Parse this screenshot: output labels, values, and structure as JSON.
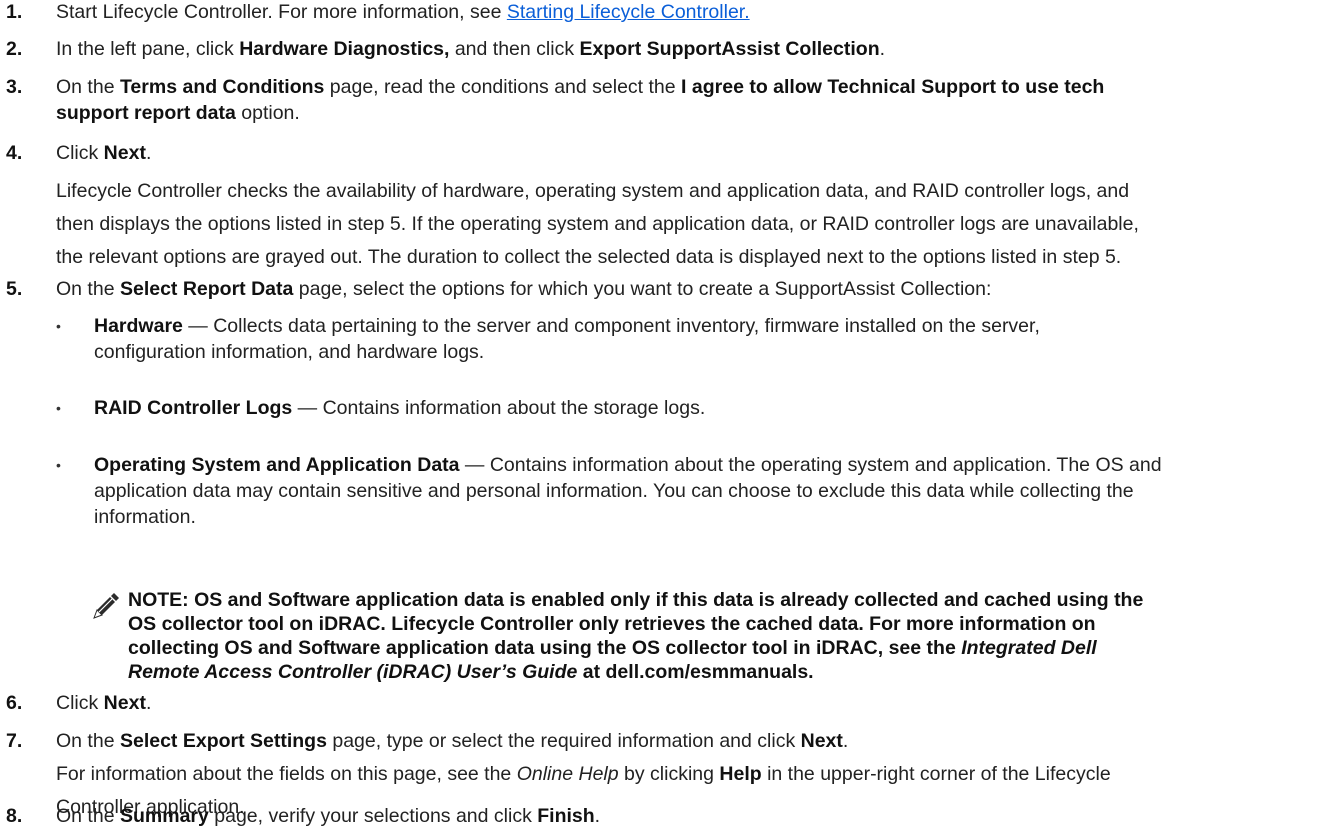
{
  "steps": [
    {
      "num": "1.",
      "pre": "Start Lifecycle Controller. For more information, see ",
      "link": "Starting Lifecycle Controller."
    },
    {
      "num": "2.",
      "t1": "In the left pane, click ",
      "b1": "Hardware Diagnostics,",
      "t2": " and then click ",
      "b2": "Export SupportAssist Collection",
      "t3": "."
    },
    {
      "num": "3.",
      "t1": "On the ",
      "b1": "Terms and Conditions",
      "t2": " page, read the conditions and select the ",
      "b2": "I agree to allow Technical Support to use tech",
      "b3": "support report data",
      "t3": " option."
    },
    {
      "num": "4.",
      "t1": "Click ",
      "b1": "Next",
      "t2": ".",
      "para": [
        "Lifecycle Controller checks the availability of hardware, operating system and application data, and RAID controller logs, and",
        "then displays the options listed in step 5. If the operating system and application data, or RAID controller logs are unavailable,",
        "the relevant options are grayed out. The duration to collect the selected data is displayed next to the options listed in step 5."
      ]
    },
    {
      "num": "5.",
      "t1": "On the ",
      "b1": "Select Report Data",
      "t2": " page, select the options for which you want to create a SupportAssist Collection:"
    },
    {
      "num": "6.",
      "t1": "Click ",
      "b1": "Next",
      "t2": "."
    },
    {
      "num": "7.",
      "t1": "On the ",
      "b1": "Select Export Settings",
      "t2": " page, type or select the required information and click ",
      "b2": "Next",
      "t3": ".",
      "p1": "For information about the fields on this page, see the ",
      "pi": "Online Help",
      "p2": " by clicking ",
      "pb": "Help",
      "p3": " in the upper-right corner of the Lifecycle",
      "p4": "Controller application."
    },
    {
      "num": "8.",
      "t1": "On the ",
      "b1": "Summary",
      "t2": " page, verify your selections and click ",
      "b2": "Finish",
      "t3": "."
    }
  ],
  "bullets": [
    {
      "dot": "•",
      "title": "Hardware",
      "lines": [
        " — Collects data pertaining to the server and component inventory, firmware installed on the server,",
        "configuration information, and hardware logs."
      ]
    },
    {
      "dot": "•",
      "title": "RAID Controller Logs",
      "lines": [
        " — Contains information about the storage logs."
      ]
    },
    {
      "dot": "•",
      "title": "Operating System and Application Data",
      "lines": [
        " — Contains information about the operating system and application. The OS and",
        "application data may contain sensitive and personal information. You can choose to exclude this data while collecting the",
        "information."
      ]
    }
  ],
  "note": {
    "icon": "pencil-note-icon",
    "l1": "NOTE: OS and Software application data is enabled only if this data is already collected and cached using the",
    "l2": "OS collector tool on iDRAC. Lifecycle Controller only retrieves the cached data. For more information on",
    "l3": "collecting OS and Software application data using the OS collector tool in iDRAC, see the ",
    "l3i": "Integrated Dell",
    "l4i": "Remote Access Controller (iDRAC) User’s Guide",
    "l4": " at dell.com/esmmanuals."
  }
}
